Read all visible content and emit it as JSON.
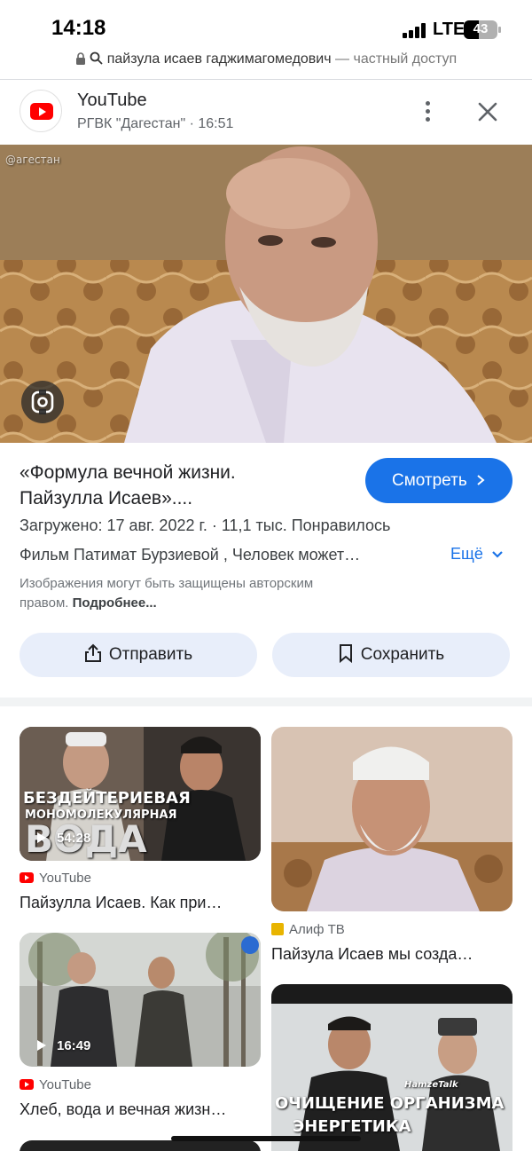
{
  "status_bar": {
    "time": "14:18",
    "network": "LTE",
    "battery": "43"
  },
  "url_bar": {
    "query": "пайзула исаев гаджимагомедович",
    "separator": "—",
    "mode": "частный доступ"
  },
  "source": {
    "name": "YouTube",
    "channel_line": "РГВК \"Дагестан\" · 16:51"
  },
  "main_result": {
    "title_line1": "«Формула вечной жизни.",
    "title_line2": "Пайзулла Исаев»....",
    "watch_button": "Смотреть",
    "uploaded": "Загружено: 17 авг. 2022 г.  ·  11,1 тыс. Понравилось",
    "description": "Фильм Патимат Бурзиевой , Человек может…",
    "more_label": "Ещё",
    "copyright_line1": "Изображения могут быть защищены авторским",
    "copyright_line2": "правом.",
    "copyright_more": "Подробнее...",
    "share_button": "Отправить",
    "save_button": "Сохранить",
    "image_watermark": "@агестан"
  },
  "related": [
    {
      "source": "YouTube",
      "title": "Пайзулла Исаев. Как при…",
      "duration": "54:28",
      "overlay_line1": "БЕЗДЕЙТЕРИЕВАЯ",
      "overlay_line2": "МОНОМОЛЕКУЛЯРНАЯ",
      "overlay_line3": "ВОДА"
    },
    {
      "source": "Алиф ТВ",
      "title": "Пайзула Исаев мы созда…"
    },
    {
      "source": "YouTube",
      "title": "Хлеб, вода и вечная жизн…",
      "duration": "16:49"
    },
    {
      "overlay_line1": "ОЧИЩЕНИЕ ОРГАНИЗМА",
      "overlay_line2": "ЭНЕРГЕТИКА",
      "overlay_tag": "HamzeTalk"
    }
  ],
  "colors": {
    "accent": "#1a73e8",
    "youtube_red": "#ff0000",
    "pill_bg": "#e8eefa"
  }
}
